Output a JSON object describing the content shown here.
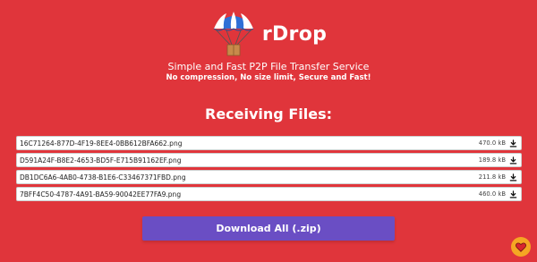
{
  "app": {
    "title": "rDrop",
    "tagline": "Simple and Fast P2P File Transfer Service",
    "subtagline": "No compression, No size limit, Secure and Fast!"
  },
  "receiving": {
    "title": "Receiving Files:",
    "files": [
      {
        "name": "16C71264-877D-4F19-8EE4-0BB612BFA662.png",
        "size": "470.0 kB"
      },
      {
        "name": "D591A24F-B8E2-4653-BD5F-E715B91162EF.png",
        "size": "189.8 kB"
      },
      {
        "name": "DB1DC6A6-4AB0-4738-B1E6-C33467371FBD.png",
        "size": "211.8 kB"
      },
      {
        "name": "7BFF4C50-4787-4A91-BA59-90042EE77FA9.png",
        "size": "460.0 kB"
      }
    ]
  },
  "actions": {
    "download_all_label": "Download All (.zip)"
  },
  "icons": {
    "logo": "parachute-icon",
    "file_download": "download-icon",
    "favorite": "heart-icon"
  },
  "colors": {
    "background": "#e0353b",
    "button": "#6a4ec4",
    "heart_badge": "#f5a623"
  }
}
